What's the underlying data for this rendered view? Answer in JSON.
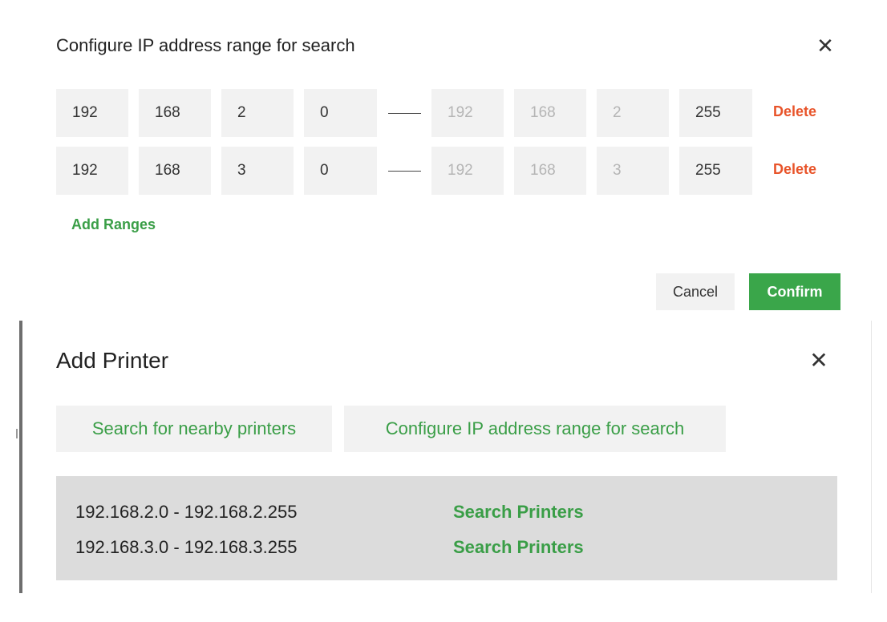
{
  "config_dialog": {
    "title": "Configure IP address range for search",
    "close_icon": "close-icon",
    "ranges": [
      {
        "start": [
          "192",
          "168",
          "2",
          "0"
        ],
        "end": [
          "192",
          "168",
          "2",
          "255"
        ],
        "delete_label": "Delete"
      },
      {
        "start": [
          "192",
          "168",
          "3",
          "0"
        ],
        "end": [
          "192",
          "168",
          "3",
          "255"
        ],
        "delete_label": "Delete"
      }
    ],
    "add_ranges_label": "Add Ranges",
    "cancel_label": "Cancel",
    "confirm_label": "Confirm"
  },
  "add_printer": {
    "title": "Add Printer",
    "close_icon": "close-icon",
    "tabs": [
      {
        "label": "Search for nearby printers"
      },
      {
        "label": "Configure IP address range for search"
      }
    ],
    "results": [
      {
        "range": "192.168.2.0 - 192.168.2.255",
        "action": "Search Printers"
      },
      {
        "range": "192.168.3.0 - 192.168.3.255",
        "action": "Search Printers"
      }
    ]
  },
  "colors": {
    "accent_green": "#3aa64a",
    "link_green": "#3a9e47",
    "delete_red": "#e8542a",
    "field_bg": "#f2f2f2",
    "results_bg": "#dcdcdc"
  }
}
